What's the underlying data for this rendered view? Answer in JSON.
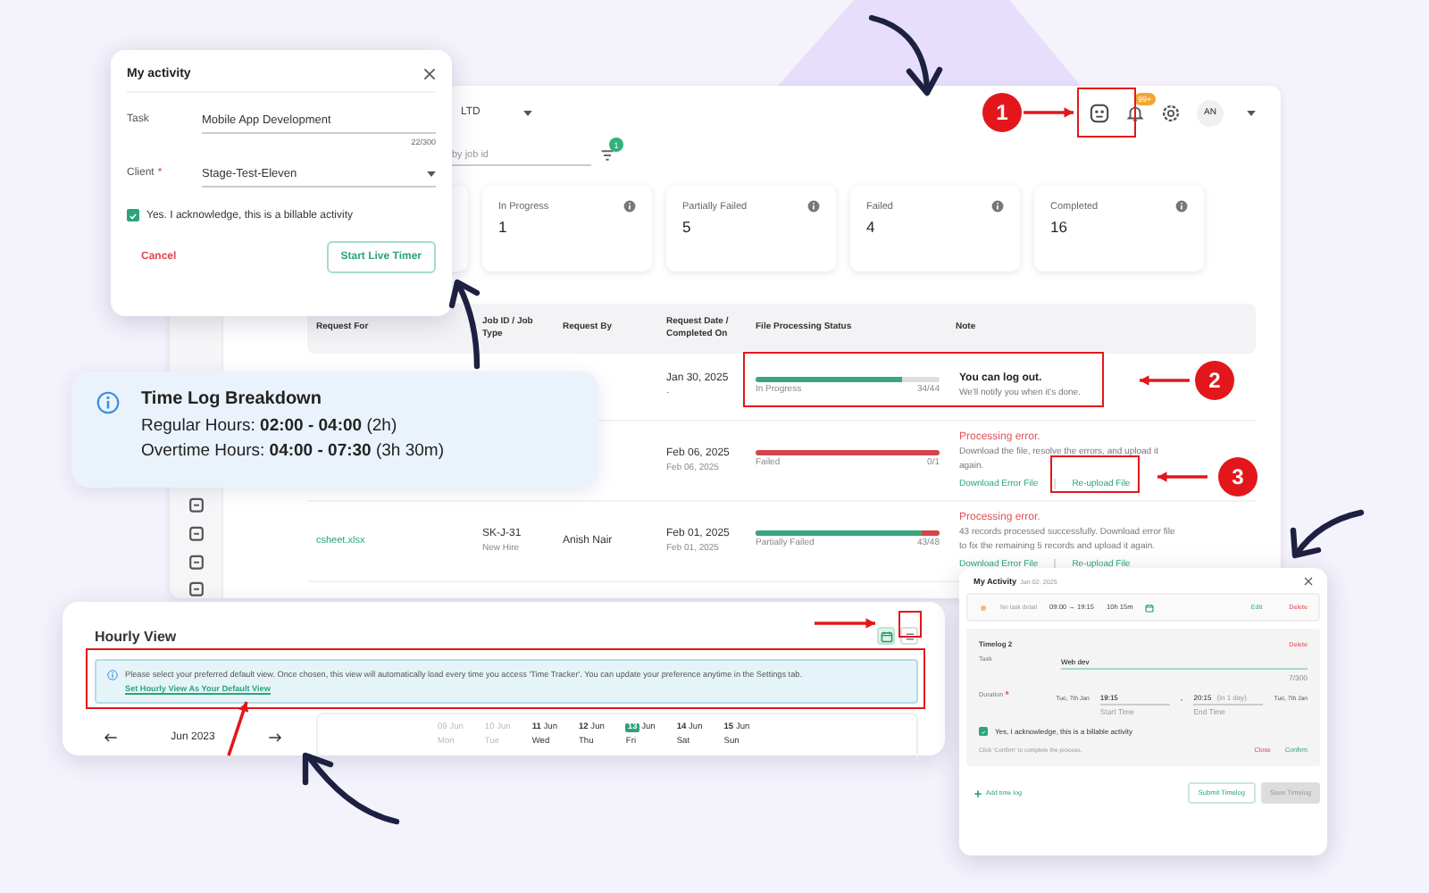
{
  "app": {
    "org": "LTD",
    "search": {
      "placeholder": "by job id"
    },
    "filter_count": "1",
    "notification_count": "99+",
    "avatar": "AN"
  },
  "stats": [
    {
      "label": "In Progress",
      "value": "1"
    },
    {
      "label": "Partially Failed",
      "value": "5"
    },
    {
      "label": "Failed",
      "value": "4"
    },
    {
      "label": "Completed",
      "value": "16"
    }
  ],
  "table": {
    "columns": [
      "Request For",
      "Job ID / Job Type",
      "Request By",
      "Request Date / Completed On",
      "File Processing Status",
      "Note"
    ],
    "rows": [
      {
        "date": "Jan 30, 2025",
        "completed": "-",
        "status": {
          "kind": "in_progress",
          "label": "In Progress",
          "count": "34/44",
          "level": 0.8
        },
        "note": {
          "kind": "info",
          "title": "You can log out.",
          "text": "We'll notify you when it's done."
        }
      },
      {
        "date": "Feb 06, 2025",
        "completed": "Feb 06, 2025",
        "status": {
          "kind": "failed",
          "label": "Failed",
          "count": "0/1",
          "level": 0
        },
        "note": {
          "kind": "error",
          "title": "Processing error.",
          "text": "Download the file, resolve the errors, and upload it again.",
          "links": [
            "Download Error File",
            "Re-upload File"
          ]
        }
      },
      {
        "request_for": "csheet.xlsx",
        "job_id": "SK-J-31",
        "job_type": "New Hire",
        "request_by": "Anish Nair",
        "date": "Feb 01, 2025",
        "completed": "Feb 01, 2025",
        "status": {
          "kind": "partial",
          "label": "Partially Failed",
          "count": "43/48",
          "level": 0.9
        },
        "note": {
          "kind": "error",
          "title": "Processing error.",
          "text": "43 records processed successfully. Download error file to fix the remaining 5 records and upload it again.",
          "links": [
            "Download Error File",
            "Re-upload File"
          ]
        }
      }
    ]
  },
  "activity_popup": {
    "title": "My activity",
    "task_label": "Task",
    "task_value": "Mobile App Development",
    "task_counter": "22/300",
    "client_label": "Client",
    "required_mark": "*",
    "client_value": "Stage-Test-Eleven",
    "billable": {
      "label": "Yes. I acknowledge, this is a billable activity",
      "checked": true
    },
    "cancel": "Cancel",
    "start": "Start Live Timer"
  },
  "time_log": {
    "title": "Time Log Breakdown",
    "lines": [
      "Regular Hours: **02:00 - 04:00** (2h)",
      "Overtime Hours: **04:00 - 07:30** (3h 30m)"
    ]
  },
  "hourly": {
    "title": "Hourly View",
    "views": [
      {
        "kind": "calendar",
        "selected": true
      },
      {
        "kind": "list",
        "selected": false
      }
    ],
    "notice": "Please select your preferred default view. Once chosen, this view will automatically load every time you access 'Time Tracker'. You can update your preference anytime in the Settings tab.",
    "notice_link": "Set Hourly View As Your Default View",
    "month": "Jun 2023",
    "days": [
      {
        "num": "09",
        "month": "Jun",
        "weekday": "Mon",
        "disabled": true,
        "selected": false
      },
      {
        "num": "10",
        "month": "Jun",
        "weekday": "Tue",
        "disabled": true,
        "selected": false
      },
      {
        "num": "11",
        "month": "Jun",
        "weekday": "Wed",
        "disabled": false,
        "selected": false
      },
      {
        "num": "12",
        "month": "Jun",
        "weekday": "Thu",
        "disabled": false,
        "selected": false
      },
      {
        "num": "13",
        "month": "Jun",
        "weekday": "Fri",
        "disabled": false,
        "selected": true
      },
      {
        "num": "14",
        "month": "Jun",
        "weekday": "Sat",
        "disabled": false,
        "selected": false
      },
      {
        "num": "15",
        "month": "Jun",
        "weekday": "Sun",
        "disabled": false,
        "selected": false
      }
    ]
  },
  "activity_detail": {
    "title": "My Activity",
    "date": "Jan 02, 2025",
    "entry": {
      "task": "No task detail",
      "time": "09:00 → 19:15",
      "duration": "10h 15m",
      "edit": "Edit",
      "delete": "Delete"
    },
    "timelog": {
      "title": "Timelog 2",
      "delete": "Delete",
      "task_label": "Task",
      "task_value": "Web dev",
      "task_counter": "7/300",
      "duration_label": "Duration",
      "required_mark": "*",
      "start_date": "Tue, 7th Jan",
      "start_time": "19:15",
      "start_caption": "Start Time",
      "separator": "-",
      "end_time": "20:15",
      "end_hint": "(in 1 day)",
      "end_caption": "End Time",
      "end_date": "Tue, 7th Jan",
      "billable": {
        "label": "Yes, I acknowledge, this is a billable activity",
        "checked": true
      },
      "hint": "Click 'Confirm' to complete the process.",
      "close": "Close",
      "confirm": "Confirm"
    },
    "add": "Add time log",
    "submit": "Submit Timelog",
    "save": {
      "label": "Save Timelog",
      "disabled": true
    }
  },
  "callouts": [
    "1",
    "2",
    "3"
  ]
}
